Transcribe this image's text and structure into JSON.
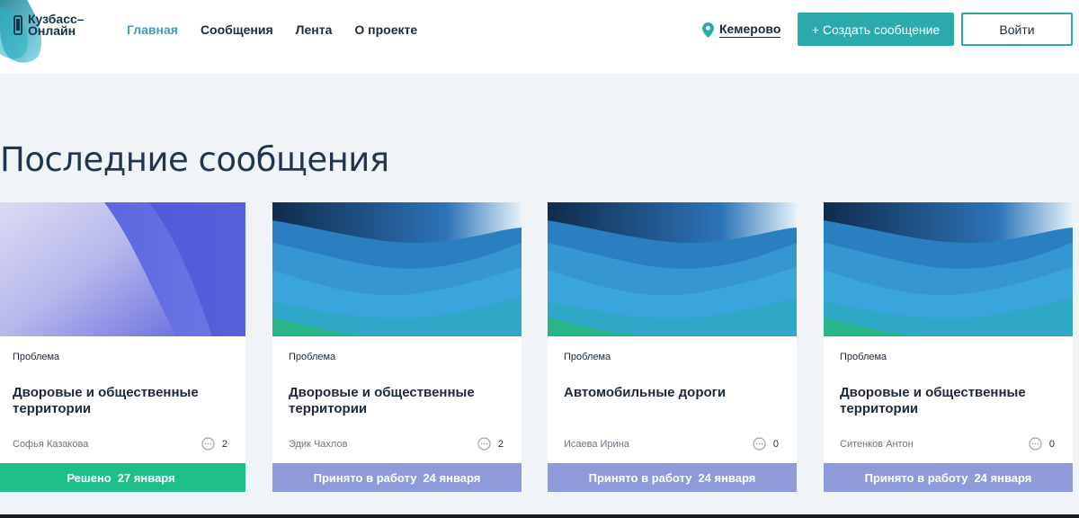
{
  "header": {
    "logo_text": "Кузбасс–\nОнлайн",
    "nav": [
      "Главная",
      "Сообщения",
      "Лента",
      "О проекте"
    ],
    "city": "Кемерово",
    "create_button": "+ Создать сообщение",
    "login_button": "Войти"
  },
  "section_title": "Последние сообщения",
  "cards": [
    {
      "category": "Проблема",
      "title": "Дворовые и общественные территории",
      "author": "Софья Казакова",
      "comments": "2",
      "status": "Решено",
      "date": "27 января",
      "status_color": "#1fbf8a",
      "image": "snow"
    },
    {
      "category": "Проблема",
      "title": "Дворовые и общественные территории",
      "author": "Эдик Чахлов",
      "comments": "2",
      "status": "Принято в работу",
      "date": "24 января",
      "status_color": "#8f9bd8",
      "image": "waves"
    },
    {
      "category": "Проблема",
      "title": "Автомобильные дороги",
      "author": "Исаева Ирина",
      "comments": "0",
      "status": "Принято в работу",
      "date": "24 января",
      "status_color": "#8f9bd8",
      "image": "waves"
    },
    {
      "category": "Проблема",
      "title": "Дворовые и общественные территории",
      "author": "Ситенков Антон",
      "comments": "0",
      "status": "Принято в работу",
      "date": "24 января",
      "status_color": "#8f9bd8",
      "image": "waves"
    }
  ],
  "colors": {
    "accent": "#2ba9ab",
    "nav_active": "#3d9ac8",
    "status_done": "#1fbf8a",
    "status_in_work": "#8f9bd8"
  }
}
